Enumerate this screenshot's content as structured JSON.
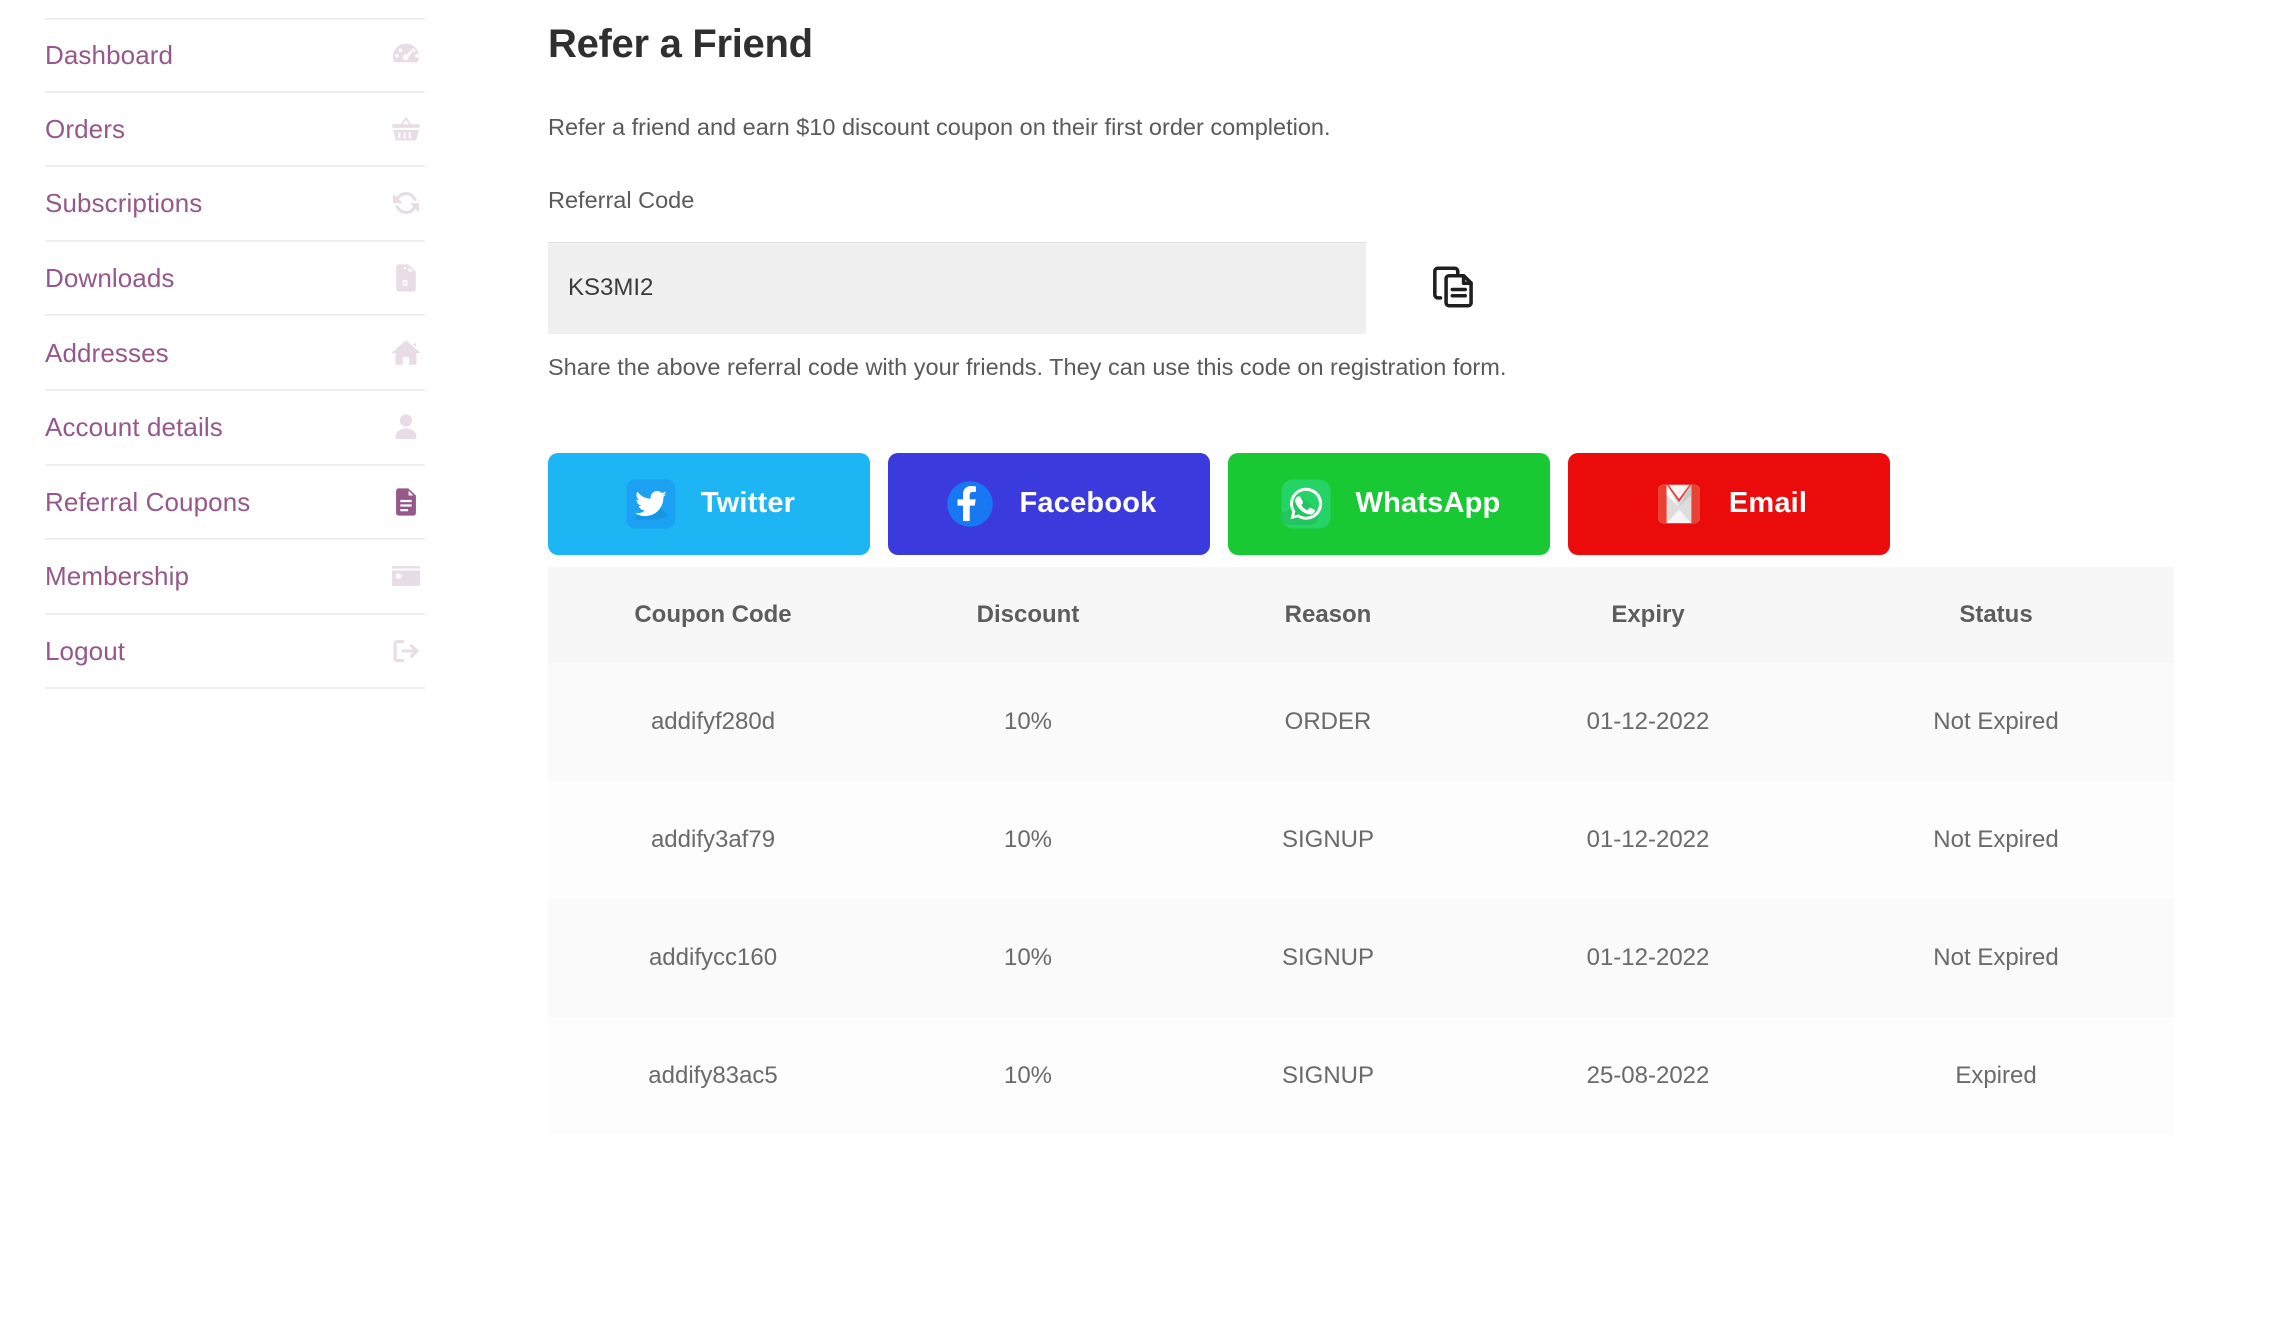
{
  "sidebar": {
    "items": [
      {
        "label": "Dashboard",
        "icon": "gauge-icon",
        "active": false
      },
      {
        "label": "Orders",
        "icon": "basket-icon",
        "active": false
      },
      {
        "label": "Subscriptions",
        "icon": "refresh-icon",
        "active": false
      },
      {
        "label": "Downloads",
        "icon": "file-zip-icon",
        "active": false
      },
      {
        "label": "Addresses",
        "icon": "home-icon",
        "active": false
      },
      {
        "label": "Account details",
        "icon": "user-icon",
        "active": false
      },
      {
        "label": "Referral Coupons",
        "icon": "document-icon",
        "active": true
      },
      {
        "label": "Membership",
        "icon": "id-card-icon",
        "active": false
      },
      {
        "label": "Logout",
        "icon": "sign-out-icon",
        "active": false
      }
    ]
  },
  "main": {
    "title": "Refer a Friend",
    "intro": "Refer a friend and earn $10 discount coupon on their first order completion.",
    "referral_code_label": "Referral Code",
    "referral_code_value": "KS3MI2",
    "referral_code_placeholder": "Referral Code",
    "copy_icon": "copy-icon",
    "hint": "Share the above referral code with your friends. They can use this code on registration form."
  },
  "share_buttons": [
    {
      "label": "Twitter",
      "icon": "twitter-icon",
      "color": "#1eb5f5"
    },
    {
      "label": "Facebook",
      "icon": "facebook-icon",
      "color": "#3b3bdd"
    },
    {
      "label": "WhatsApp",
      "icon": "whatsapp-icon",
      "color": "#18c934"
    },
    {
      "label": "Email",
      "icon": "gmail-icon",
      "color": "#ec0b0b"
    }
  ],
  "table": {
    "headers": [
      "Coupon Code",
      "Discount",
      "Reason",
      "Expiry",
      "Status"
    ],
    "rows": [
      {
        "code": "addifyf280d",
        "discount": "10%",
        "reason": "ORDER",
        "expiry": "01-12-2022",
        "status": "Not Expired"
      },
      {
        "code": "addify3af79",
        "discount": "10%",
        "reason": "SIGNUP",
        "expiry": "01-12-2022",
        "status": "Not Expired"
      },
      {
        "code": "addifycc160",
        "discount": "10%",
        "reason": "SIGNUP",
        "expiry": "01-12-2022",
        "status": "Not Expired"
      },
      {
        "code": "addify83ac5",
        "discount": "10%",
        "reason": "SIGNUP",
        "expiry": "25-08-2022",
        "status": "Expired"
      }
    ]
  }
}
